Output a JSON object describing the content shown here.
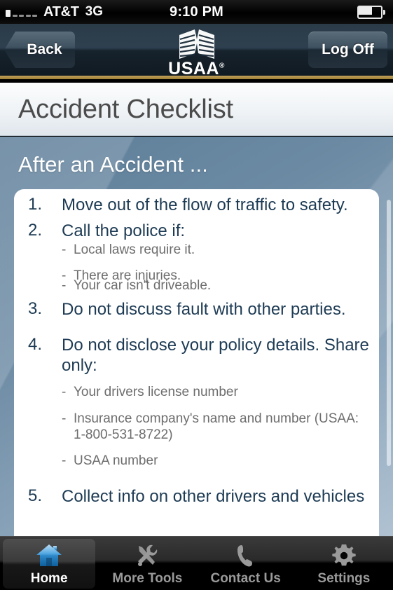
{
  "status_bar": {
    "carrier": "AT&T",
    "network": "3G",
    "time": "9:10 PM",
    "signal_icon": "signal-bars-icon",
    "battery_icon": "battery-icon"
  },
  "nav_bar": {
    "back_label": "Back",
    "logoff_label": "Log Off",
    "logo_word": "USAA",
    "logo_trademark": "®",
    "logo_icon": "usaa-eagle-logo-icon",
    "accent_gold": "#a98a3e"
  },
  "header": {
    "page_title": "Accident Checklist"
  },
  "main": {
    "section_heading": "After an Accident ...",
    "text_color": "#1d3b54",
    "sub_text_color": "#6d6d6d",
    "background_color": "#6c8aa3",
    "checklist": [
      {
        "number": "1.",
        "text": "Move out of the flow of traffic to safety.",
        "subitems": []
      },
      {
        "number": "2.",
        "text": "Call the police if:",
        "subitems": [
          "Local laws require it.",
          "There are injuries.",
          "Your car isn't driveable."
        ]
      },
      {
        "number": "3.",
        "text": "Do not discuss fault with other parties.",
        "subitems": []
      },
      {
        "number": "4.",
        "text": "Do not disclose your policy details. Share only:",
        "subitems": [
          "Your drivers license number",
          "Insurance company's name and number (USAA: 1-800-531-8722)",
          "USAA number"
        ]
      },
      {
        "number": "5.",
        "text": "Collect info on other drivers and vehicles",
        "subitems": []
      }
    ]
  },
  "tab_bar": {
    "active_tab": "Home",
    "active_color": "#49a5e0",
    "tabs": [
      {
        "label": "Home",
        "icon": "home-icon"
      },
      {
        "label": "More Tools",
        "icon": "tools-icon"
      },
      {
        "label": "Contact Us",
        "icon": "phone-icon"
      },
      {
        "label": "Settings",
        "icon": "gear-icon"
      }
    ]
  }
}
